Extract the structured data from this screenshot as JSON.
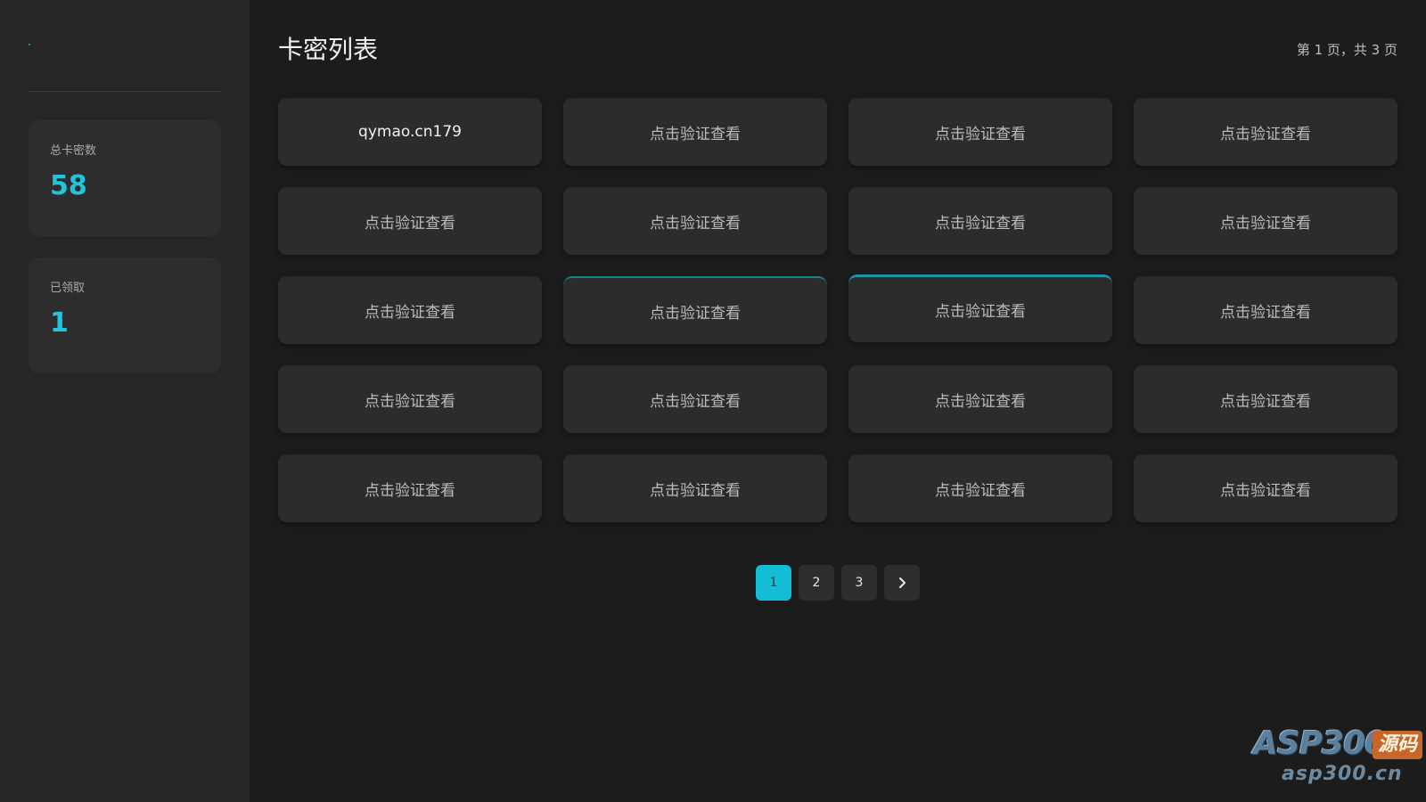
{
  "sidebar": {
    "stats": [
      {
        "label": "总卡密数",
        "value": "58"
      },
      {
        "label": "已领取",
        "value": "1"
      }
    ]
  },
  "header": {
    "title": "卡密列表",
    "page_info": "第 1 页，共 3 页"
  },
  "cards": [
    "qymao.cn179",
    "点击验证查看",
    "点击验证查看",
    "点击验证查看",
    "点击验证查看",
    "点击验证查看",
    "点击验证查看",
    "点击验证查看",
    "点击验证查看",
    "点击验证查看",
    "点击验证查看",
    "点击验证查看",
    "点击验证查看",
    "点击验证查看",
    "点击验证查看",
    "点击验证查看",
    "点击验证查看",
    "点击验证查看",
    "点击验证查看",
    "点击验证查看"
  ],
  "pagination": {
    "pages": [
      "1",
      "2",
      "3"
    ],
    "current": "1",
    "next_icon": "chevron-right-icon"
  },
  "watermark": {
    "brand": "ASP300",
    "tag": "源码",
    "url": "asp300.cn"
  },
  "colors": {
    "accent": "#14bdd6",
    "stat_value": "#22c4dc",
    "background": "#1c1c1c",
    "sidebar": "#262626",
    "card": "#2c2c2c"
  }
}
